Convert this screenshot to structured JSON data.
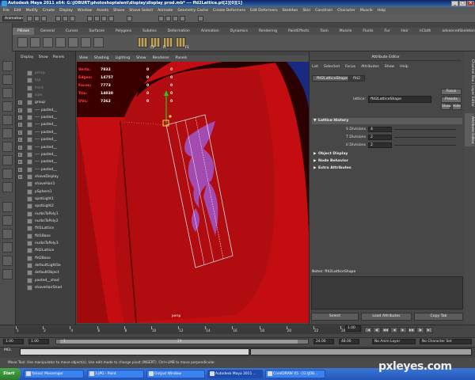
{
  "window": {
    "title": "Autodesk Maya 2011 x64: G:\\JOBURT\\photoshoptalent\\display\\display prod.mb* --- ffd2Lattice.pt[2][0][1]",
    "buttons": [
      "_",
      "□",
      "×"
    ]
  },
  "menubar": [
    "File",
    "Edit",
    "Modify",
    "Create",
    "Display",
    "Window",
    "Assets",
    "Shave",
    "Shave Select",
    "Animate",
    "Geometry Cache",
    "Create Deformers",
    "Edit Deformers",
    "Skeleton",
    "Skin",
    "Constrain",
    "Character",
    "Muscle",
    "Help"
  ],
  "status_line": {
    "mode": "Animation"
  },
  "shelf": {
    "tabs": [
      "Pillows",
      "General",
      "Curves",
      "Surfaces",
      "Polygons",
      "Subdivs",
      "Deformation",
      "Animation",
      "Dynamics",
      "Rendering",
      "PaintEffects",
      "Toon",
      "Muscle",
      "Fluids",
      "Fur",
      "Hair",
      "nCloth",
      "advancedSkeleton"
    ],
    "active_tab": "Pillows",
    "icon_labels": [
      "CP",
      "FI",
      "F1"
    ]
  },
  "outliner": {
    "menu": [
      "Display",
      "Show",
      "Panels"
    ],
    "items": [
      {
        "label": "persp",
        "dim": true,
        "expandable": false
      },
      {
        "label": "top",
        "dim": true,
        "expandable": false
      },
      {
        "label": "front",
        "dim": true,
        "expandable": false
      },
      {
        "label": "side",
        "dim": true,
        "expandable": false
      },
      {
        "label": "group",
        "dim": false,
        "expandable": true
      },
      {
        "label": "---- pasted__",
        "dim": false,
        "expandable": true
      },
      {
        "label": "---- pasted__",
        "dim": false,
        "expandable": true
      },
      {
        "label": "---- pasted__",
        "dim": false,
        "expandable": true
      },
      {
        "label": "---- pasted__",
        "dim": false,
        "expandable": true
      },
      {
        "label": "---- pasted__",
        "dim": false,
        "expandable": true
      },
      {
        "label": "---- pasted__",
        "dim": false,
        "expandable": true
      },
      {
        "label": "---- pasted__",
        "dim": false,
        "expandable": true
      },
      {
        "label": "---- pasted__",
        "dim": false,
        "expandable": true
      },
      {
        "label": "---- pasted__",
        "dim": false,
        "expandable": true
      },
      {
        "label": "shaveDisplay",
        "dim": false,
        "expandable": true
      },
      {
        "label": "shaveHair1",
        "dim": false,
        "expandable": false
      },
      {
        "label": "pSphere1",
        "dim": false,
        "expandable": false
      },
      {
        "label": "spotLight1",
        "dim": false,
        "expandable": false
      },
      {
        "label": "spotLight2",
        "dim": false,
        "expandable": false
      },
      {
        "label": "nurbsToPoly1",
        "dim": false,
        "expandable": false
      },
      {
        "label": "nurbsToPoly2",
        "dim": false,
        "expandable": false
      },
      {
        "label": "ffd1Lattice",
        "dim": false,
        "expandable": false
      },
      {
        "label": "ffd1Base",
        "dim": false,
        "expandable": false
      },
      {
        "label": "nurbsToPoly3",
        "dim": false,
        "expandable": false
      },
      {
        "label": "ffd2Lattice",
        "dim": false,
        "expandable": false
      },
      {
        "label": "ffd2Base",
        "dim": false,
        "expandable": false
      },
      {
        "label": "defaultLightSe",
        "dim": false,
        "expandable": false
      },
      {
        "label": "defaultObject",
        "dim": false,
        "expandable": false
      },
      {
        "label": "pasted__shad",
        "dim": false,
        "expandable": false
      },
      {
        "label": "shaveHairShad",
        "dim": false,
        "expandable": false
      }
    ]
  },
  "viewport": {
    "menu": [
      "View",
      "Shading",
      "Lighting",
      "Show",
      "Renderer",
      "Panels"
    ],
    "hud": [
      {
        "label": "Verts:",
        "value": "7832",
        "sel": "0",
        "extra": "0"
      },
      {
        "label": "Edges:",
        "value": "14757",
        "sel": "0",
        "extra": "0"
      },
      {
        "label": "Faces:",
        "value": "7773",
        "sel": "0",
        "extra": "0"
      },
      {
        "label": "Tris:",
        "value": "14030",
        "sel": "0",
        "extra": "0"
      },
      {
        "label": "UVs:",
        "value": "7262",
        "sel": "0",
        "extra": "0"
      }
    ],
    "colors": {
      "background": "#c40d10",
      "lattice": "#c8c8d8",
      "decal": "#a34bb0"
    }
  },
  "attribute_editor": {
    "header": "Attribute Editor",
    "menu": [
      "List",
      "Selected",
      "Focus",
      "Attributes",
      "Show",
      "Help"
    ],
    "tabs": [
      "ffd2LatticeShape",
      "ffd2"
    ],
    "active_tab": "ffd2LatticeShape",
    "lattice_label": "lattice:",
    "lattice_value": "ffd2LatticeShape",
    "buttons": [
      "Focus",
      "Presets",
      "Show",
      "Hide"
    ],
    "sections": [
      {
        "title": "Lattice History",
        "open": true
      },
      {
        "title": "Object Display",
        "open": false
      },
      {
        "title": "Node Behavior",
        "open": false
      },
      {
        "title": "Extra Attributes",
        "open": false
      }
    ],
    "divisions": [
      {
        "label": "S Divisions",
        "value": "4"
      },
      {
        "label": "T Divisions",
        "value": "2"
      },
      {
        "label": "U Divisions",
        "value": "2"
      }
    ],
    "notes_label": "Notes: ffd2LatticeShape",
    "bottom_buttons": [
      "Select",
      "Load Attributes",
      "Copy Tab"
    ],
    "side_tabs": [
      "Channel Box / Layer Editor",
      "Attribute Editor"
    ]
  },
  "time_slider": {
    "ticks": [
      "1",
      "2",
      "4",
      "6",
      "8",
      "10",
      "12",
      "14",
      "16",
      "18",
      "20",
      "22",
      "24"
    ],
    "current_frame": "1.00"
  },
  "range_slider": {
    "start": "1.00",
    "inner_start": "1.00",
    "range_mid": "1",
    "range_end_label": "24",
    "end": "24.00",
    "end2": "48.00",
    "anim_layer": "No Anim Layer",
    "character_set": "No Character Set"
  },
  "command_line": {
    "label": "MEL"
  },
  "help_line": "Move Tool: Use manipulator to move object(s). Use edit mode to change pivot (INSERT). Ctrl+LMB to move perpendicular.",
  "taskbar": {
    "start": "Start",
    "tasks": [
      {
        "label": "Yahoo! Messenger",
        "active": false
      },
      {
        "label": "3.JPG - Paint",
        "active": false
      },
      {
        "label": "Output Window",
        "active": false
      },
      {
        "label": "Autodesk Maya 2011 ...",
        "active": true
      },
      {
        "label": "CorelDRAW X5 - [G:\\JOB...",
        "active": false
      }
    ]
  },
  "watermark": "pxleyes.com"
}
